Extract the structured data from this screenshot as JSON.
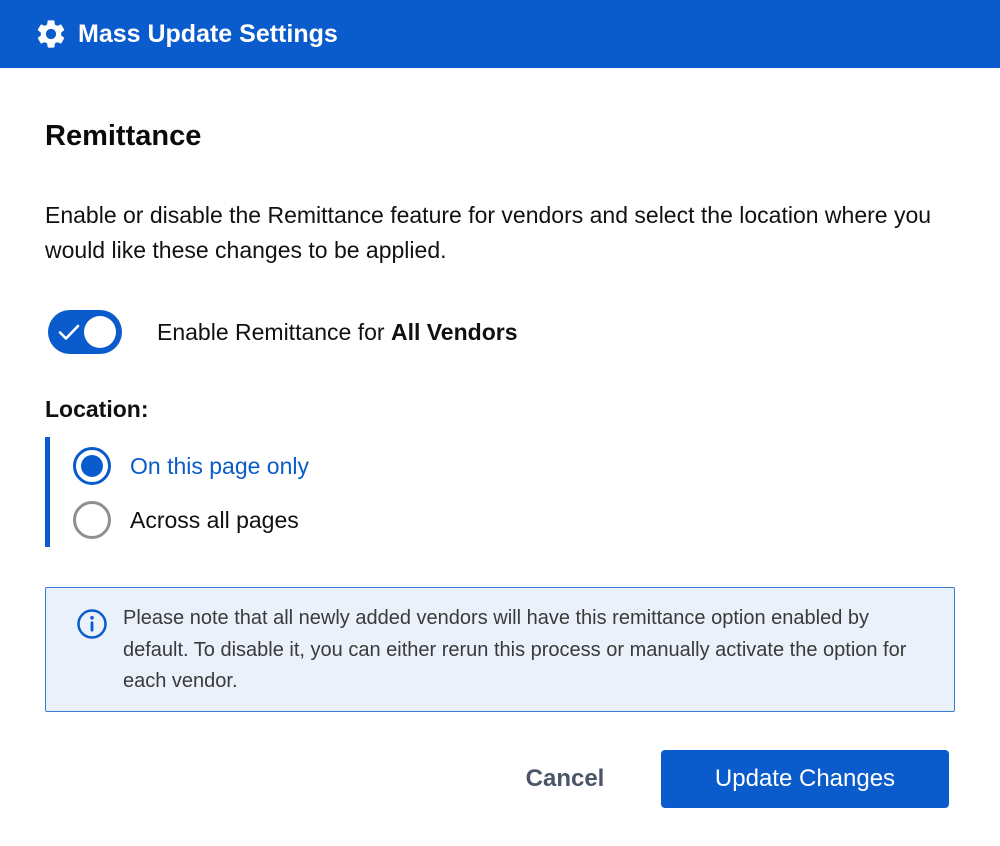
{
  "header": {
    "title": "Mass Update Settings",
    "icon": "gear-icon"
  },
  "section": {
    "title": "Remittance",
    "description": "Enable or disable the Remittance feature for vendors and select the location where you would like these changes to be applied."
  },
  "toggle": {
    "label_prefix": "Enable Remittance for ",
    "label_bold": "All Vendors",
    "enabled": true
  },
  "location": {
    "label": "Location:",
    "options": [
      {
        "label": "On this page only",
        "selected": true
      },
      {
        "label": "Across all pages",
        "selected": false
      }
    ]
  },
  "notice": {
    "icon": "info-icon",
    "text": "Please note that all newly added vendors will have this remittance option enabled by default. To disable it, you can either rerun this process or manually activate the option for each vendor."
  },
  "footer": {
    "cancel_label": "Cancel",
    "update_label": "Update Changes"
  },
  "colors": {
    "accent": "#0a5bcc",
    "notice_bg": "#eaf1fb"
  }
}
